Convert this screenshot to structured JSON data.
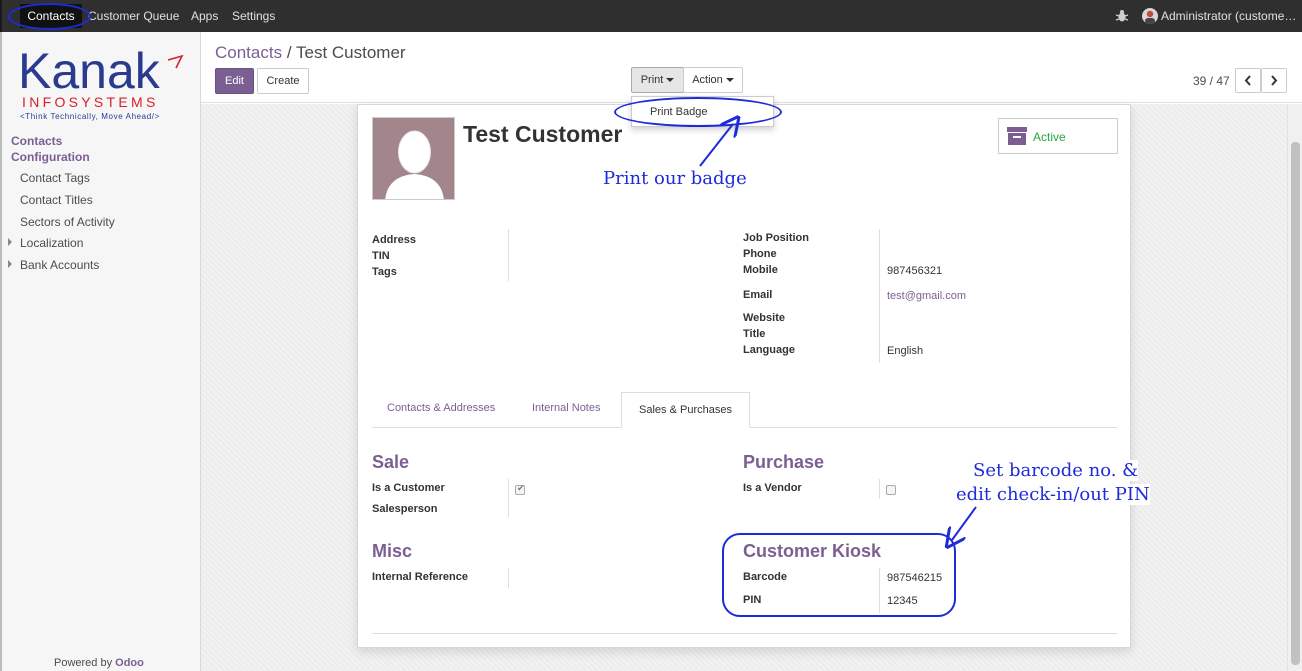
{
  "topbar": {
    "menu": [
      "Contacts",
      "Customer Queue",
      "Apps",
      "Settings"
    ],
    "user": "Administrator (custome…"
  },
  "sidebar": {
    "logo": {
      "main": "Kanak",
      "sub": "INFOSYSTEMS",
      "tagline": "<Think Technically, Move Ahead/>"
    },
    "section_contacts": "Contacts",
    "section_config": "Configuration",
    "items": [
      "Contact Tags",
      "Contact Titles",
      "Sectors of Activity",
      "Localization",
      "Bank Accounts"
    ],
    "powered": "Powered by",
    "powered_brand": "Odoo"
  },
  "control": {
    "breadcrumb_parent": "Contacts",
    "breadcrumb_sep": "/",
    "breadcrumb_current": "Test Customer",
    "edit_label": "Edit",
    "create_label": "Create",
    "print_label": "Print",
    "action_label": "Action",
    "pager": "39 / 47"
  },
  "dropdown": {
    "item": "Print Badge"
  },
  "form": {
    "name": "Test Customer",
    "active_label": "Active",
    "left_fields": [
      {
        "label": "Address",
        "value": ""
      },
      {
        "label": "TIN",
        "value": ""
      },
      {
        "label": "Tags",
        "value": ""
      }
    ],
    "right_fields": [
      {
        "label": "Job Position",
        "value": ""
      },
      {
        "label": "Phone",
        "value": ""
      },
      {
        "label": "Mobile",
        "value": "987456321"
      },
      {
        "label": "Email",
        "value": "test@gmail.com"
      },
      {
        "label": "Website",
        "value": ""
      },
      {
        "label": "Title",
        "value": ""
      },
      {
        "label": "Language",
        "value": "English"
      }
    ],
    "tabs": [
      "Contacts & Addresses",
      "Internal Notes",
      "Sales & Purchases"
    ],
    "sale": {
      "title": "Sale",
      "is_customer": "Is a Customer",
      "is_customer_checked": true,
      "salesperson": "Salesperson"
    },
    "purchase": {
      "title": "Purchase",
      "is_vendor": "Is a Vendor",
      "is_vendor_checked": false
    },
    "misc": {
      "title": "Misc",
      "internal_ref": "Internal Reference"
    },
    "kiosk": {
      "title": "Customer Kiosk",
      "barcode_label": "Barcode",
      "barcode": "987546215",
      "pin_label": "PIN",
      "pin": "12345"
    }
  },
  "annotations": {
    "print_note": "Print our badge",
    "kiosk_note_1": "Set barcode no. &",
    "kiosk_note_2": "edit check-in/out PIN"
  },
  "colors": {
    "accent": "#7c5f92",
    "active": "#28a745",
    "annotation": "#1e2bd8"
  }
}
